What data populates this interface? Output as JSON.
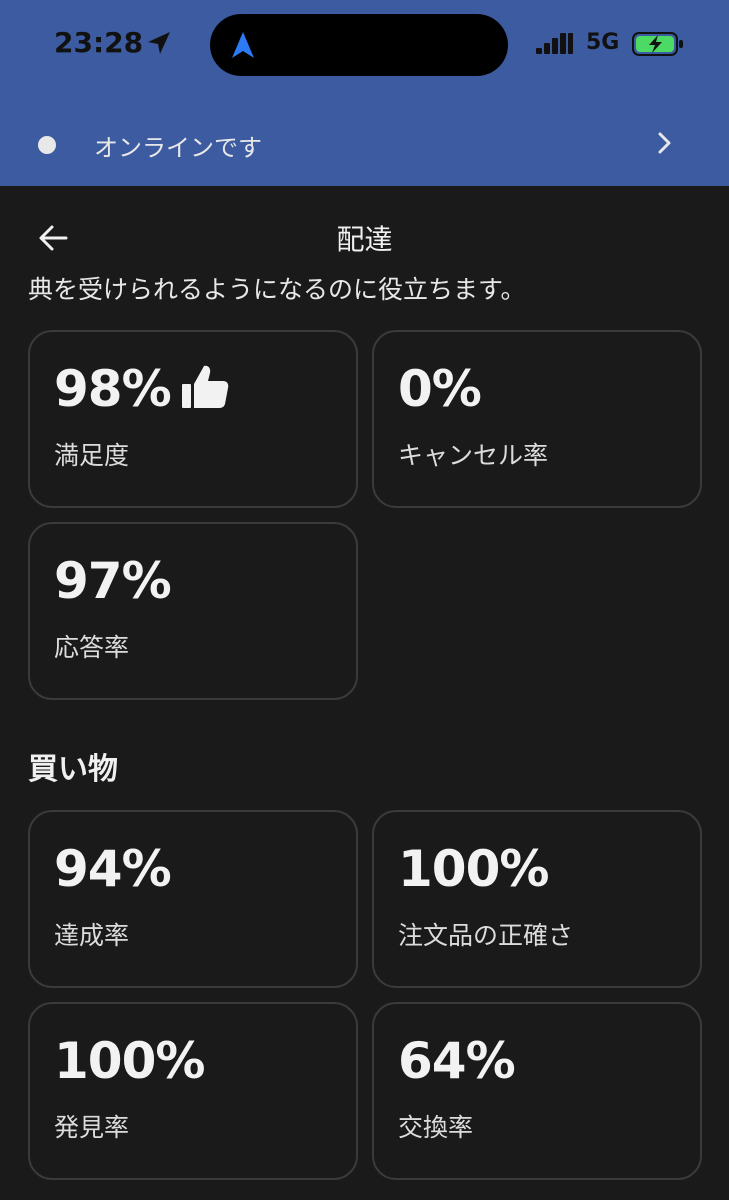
{
  "status_bar": {
    "time": "23:28",
    "network": "5G"
  },
  "online_banner": {
    "text": "オンラインです"
  },
  "header": {
    "title": "配達"
  },
  "intro": "典を受けられるようになるのに役立ちます。",
  "delivery_metrics": [
    {
      "value": "98%",
      "label": "満足度"
    },
    {
      "value": "0%",
      "label": "キャンセル率"
    },
    {
      "value": "97%",
      "label": "応答率"
    }
  ],
  "shopping": {
    "title": "買い物",
    "metrics": [
      {
        "value": "94%",
        "label": "達成率"
      },
      {
        "value": "100%",
        "label": "注文品の正確さ"
      },
      {
        "value": "100%",
        "label": "発見率"
      },
      {
        "value": "64%",
        "label": "交換率"
      }
    ]
  },
  "colors": {
    "header_blue": "#3d5ba0",
    "background": "#1a1a1a",
    "card_border": "#3a3a3a",
    "nav_arrow_blue": "#2d7bf4",
    "battery_green": "#4cd964"
  }
}
